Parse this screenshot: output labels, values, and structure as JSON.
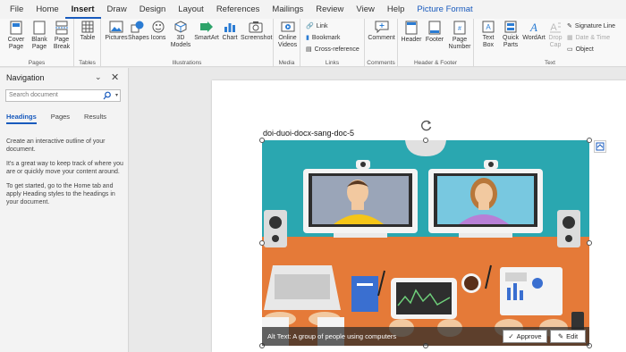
{
  "menu": {
    "tabs": [
      "File",
      "Home",
      "Insert",
      "Draw",
      "Design",
      "Layout",
      "References",
      "Mailings",
      "Review",
      "View",
      "Help",
      "Picture Format"
    ],
    "active": "Insert"
  },
  "ribbon": {
    "pages": {
      "label": "Pages",
      "cover": "Cover Page",
      "blank": "Blank Page",
      "break": "Page Break"
    },
    "tables": {
      "label": "Tables",
      "table": "Table"
    },
    "illustrations": {
      "label": "Illustrations",
      "pictures": "Pictures",
      "shapes": "Shapes",
      "icons": "Icons",
      "models": "3D Models",
      "smartart": "SmartArt",
      "chart": "Chart",
      "screenshot": "Screenshot"
    },
    "media": {
      "label": "Media",
      "online_videos": "Online Videos"
    },
    "links": {
      "label": "Links",
      "link": "Link",
      "bookmark": "Bookmark",
      "cross_reference": "Cross-reference"
    },
    "comments": {
      "label": "Comments",
      "comment": "Comment"
    },
    "header_footer": {
      "label": "Header & Footer",
      "header": "Header",
      "footer": "Footer",
      "page_number": "Page Number"
    },
    "text": {
      "label": "Text",
      "text_box": "Text Box",
      "quick_parts": "Quick Parts",
      "wordart": "WordArt",
      "drop_cap": "Drop Cap",
      "signature_line": "Signature Line",
      "date_time": "Date & Time",
      "object": "Object"
    }
  },
  "navigation": {
    "title": "Navigation",
    "search_placeholder": "Search document",
    "tabs": [
      "Headings",
      "Pages",
      "Results"
    ],
    "active_tab": "Headings",
    "body": [
      "Create an interactive outline of your document.",
      "It's a great way to keep track of where you are or quickly move your content around.",
      "To get started, go to the Home tab and apply Heading styles to the headings in your document."
    ]
  },
  "document": {
    "heading": "doi-duoi-docx-sang-doc-5",
    "alt_text": "Alt Text: A group of people using computers",
    "approve": "Approve",
    "edit": "Edit"
  },
  "colors": {
    "accent": "#185abd",
    "teal": "#2aa7b0",
    "orange": "#e57a38"
  }
}
